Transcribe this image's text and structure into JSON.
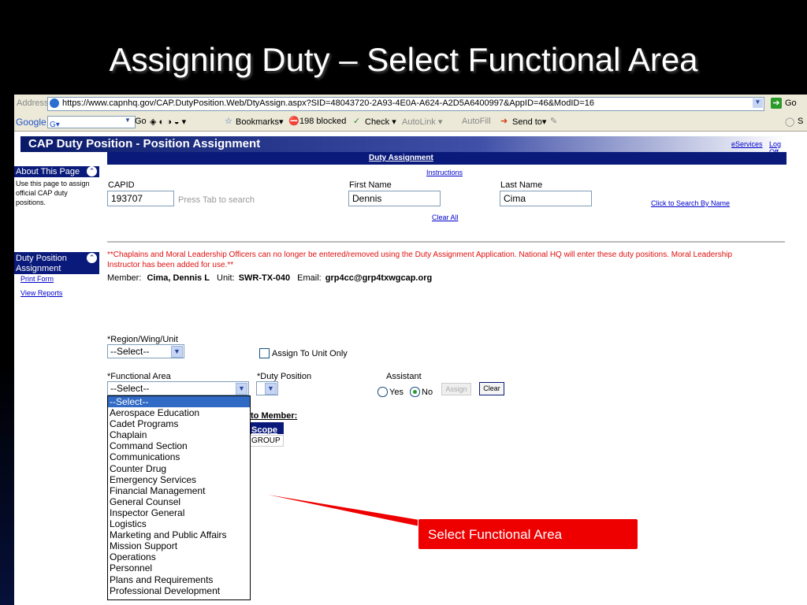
{
  "slide": {
    "title": "Assigning Duty – Select Functional Area",
    "callout": "Select Functional Area"
  },
  "browser": {
    "address_label": "Address",
    "url": "https://www.capnhq.gov/CAP.DutyPosition.Web/DtyAssign.aspx?SID=48043720-2A93-4E0A-A624-A2D5A6400997&AppID=46&ModID=16",
    "go": "Go",
    "google_label": "Google",
    "google_go": "Go",
    "bookmarks": "Bookmarks▾",
    "blocked": "198 blocked",
    "check": "Check ▾",
    "autolink": "AutoLink ▾",
    "autofill": "AutoFill",
    "send_to": "Send to▾",
    "settings_partial": "S"
  },
  "app": {
    "title": "CAP Duty Position - Position Assignment",
    "eservices": "eServices",
    "logoff": "Log Off",
    "section": "Duty Assignment",
    "instructions": "Instructions",
    "clear_all": "Clear All",
    "search_by_name": "Click to Search By Name"
  },
  "sidebar": {
    "about_title": "About This Page",
    "about_text": "Use this page to assign official CAP duty positions.",
    "duty_title": "Duty Position Assignment",
    "print_form": "Print Form",
    "view_reports": "View Reports"
  },
  "member_search": {
    "capid_label": "CAPID",
    "capid_value": "193707",
    "tab_hint": "Press Tab to search",
    "first_name_label": "First Name",
    "first_name_value": "Dennis",
    "last_name_label": "Last Name",
    "last_name_value": "Cima"
  },
  "notice": {
    "warning": "**Chaplains and Moral Leadership Officers can no longer be entered/removed using the Duty Assignment Application. National HQ will enter these duty positions. Moral Leadership Instructor has been added for use.**",
    "member_label": "Member:",
    "member_value": "Cima, Dennis L",
    "unit_label": "Unit:",
    "unit_value": "SWR-TX-040",
    "email_label": "Email:",
    "email_value": "grp4cc@grp4txwgcap.org"
  },
  "form": {
    "region_label": "*Region/Wing/Unit",
    "region_value": "--Select--",
    "assign_unit_only": "Assign To Unit Only",
    "functional_area_label": "*Functional Area",
    "functional_area_value": "--Select--",
    "duty_position_label": "*Duty Position",
    "assistant_label": "Assistant",
    "yes": "Yes",
    "no": "No",
    "assign_button": "Assign",
    "clear_button": "Clear",
    "assigned_partial": "to Member:",
    "scope_header": "Scope",
    "scope_value": "GROUP"
  },
  "functional_area_options": [
    "--Select--",
    "Aerospace Education",
    "Cadet Programs",
    "Chaplain",
    "Command Section",
    "Communications",
    "Counter Drug",
    "Emergency Services",
    "Financial Management",
    "General Counsel",
    "Inspector General",
    "Logistics",
    "Marketing and Public Affairs",
    "Mission Support",
    "Operations",
    "Personnel",
    "Plans and Requirements",
    "Professional Development"
  ],
  "colors": {
    "accent_red": "#ee0000",
    "header_blue": "#0a1a7a",
    "selected_blue": "#316ac5",
    "warning_red": "#e01010"
  }
}
